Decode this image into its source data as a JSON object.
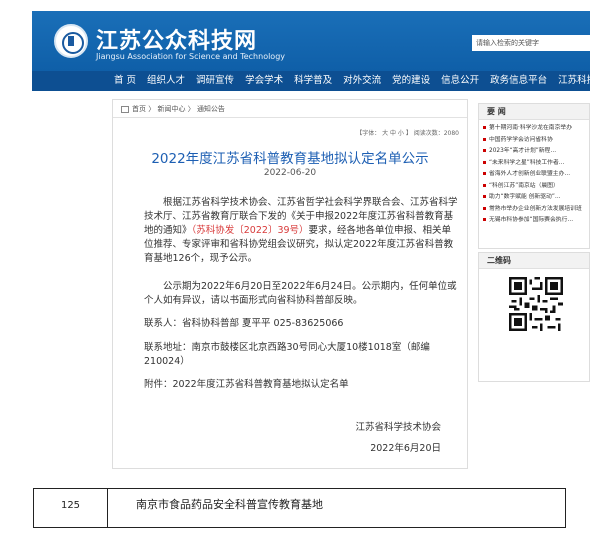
{
  "header": {
    "title": "江苏公众科技网",
    "subtitle": "Jiangsu Association for Science and Technology",
    "search_placeholder": "请输入检索的关键字",
    "background_color": "#0f5fa8"
  },
  "nav": {
    "items": [
      "首 页",
      "组织人才",
      "调研宣传",
      "学会学术",
      "科学普及",
      "对外交流",
      "党的建设",
      "信息公开",
      "政务信息平台",
      "江苏科技"
    ],
    "background_color": "#0d4f92"
  },
  "breadcrumb": [
    "首页",
    "新闻中心",
    "通知公告"
  ],
  "font_controls": "【字体： 大 中 小 】 阅读次数：2080",
  "article": {
    "title": "2022年度江苏省科普教育基地拟认定名单公示",
    "date": "2022-06-20",
    "p1_before": "根据江苏省科学技术协会、江苏省哲学社会科学界联合会、江苏省科学技术厅、江苏省教育厅联合下发的《关于申报2022年度江苏省科普教育基地的通知》",
    "p1_link": "（苏科协发〔2022〕39号）",
    "p1_after": "要求，经各地各单位申报、相关单位推荐、专家评审和省科协党组会议研究，拟认定2022年度江苏省科普教育基地126个，现予公示。",
    "p2": "公示期为2022年6月20日至2022年6月24日。公示期内，任何单位或个人如有异议，请以书面形式向省科协科普部反映。",
    "p3": "联系人：省科协科普部 夏平平  025-83625066",
    "p4": "联系地址：南京市鼓楼区北京西路30号同心大厦10楼1018室（邮编210024）",
    "p5": "附件：2022年度江苏省科普教育基地拟认定名单",
    "signature_org": "江苏省科学技术协会",
    "signature_date": "2022年6月20日",
    "title_color": "#1d5fb3",
    "link_color": "#d83a3a"
  },
  "sidebar": {
    "news_heading": "要 闻",
    "news_items": [
      "第十期河南·科学沙龙在南京举办",
      "中国药学学会访问省科协",
      "2023年“高才计划”新程…",
      "“未来科学之星”科技工作者…",
      "省海外人才创新创业联盟主办…",
      "“科创江苏”南京站（晨图）",
      "助力“数字赋能 创新驱动”…",
      "常熟市举办企业创新方法发展培训班",
      "无锡市科协参加“国际赛会执行…"
    ],
    "qr_heading": "二维码"
  },
  "table_row": {
    "number": "125",
    "name": "南京市食品药品安全科普宣传教育基地"
  }
}
